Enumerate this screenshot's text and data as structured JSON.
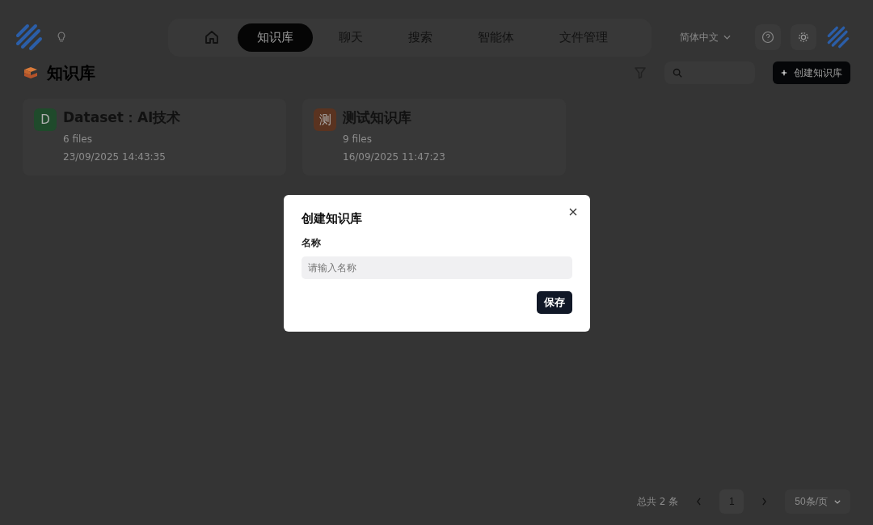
{
  "nav": {
    "tabs": [
      {
        "kind": "icon",
        "selected": false
      },
      {
        "kind": "text",
        "label": "知识库",
        "selected": true
      },
      {
        "kind": "text",
        "label": "聊天",
        "selected": false
      },
      {
        "kind": "text",
        "label": "搜索",
        "selected": false
      },
      {
        "kind": "text",
        "label": "智能体",
        "selected": false
      },
      {
        "kind": "text",
        "label": "文件管理",
        "selected": false
      }
    ],
    "language": "简体中文"
  },
  "page": {
    "title": "知识库",
    "create_button": "创建知识库"
  },
  "cards": [
    {
      "avatar": "D",
      "color": "#1f4a2b",
      "title": "Dataset：AI技术",
      "files": "6 files",
      "date": "23/09/2025 14:43:35"
    },
    {
      "avatar": "测",
      "color": "#5a3320",
      "title": "测试知识库",
      "files": "9 files",
      "date": "16/09/2025 11:47:23"
    }
  ],
  "pagination": {
    "total": "总共 2 条",
    "pages": [
      {
        "label": "1",
        "selected": true
      }
    ],
    "page_size": "50条/页"
  },
  "dialog": {
    "title": "创建知识库",
    "field_label": "名称",
    "placeholder": "请输入名称",
    "save_button": "保存"
  }
}
